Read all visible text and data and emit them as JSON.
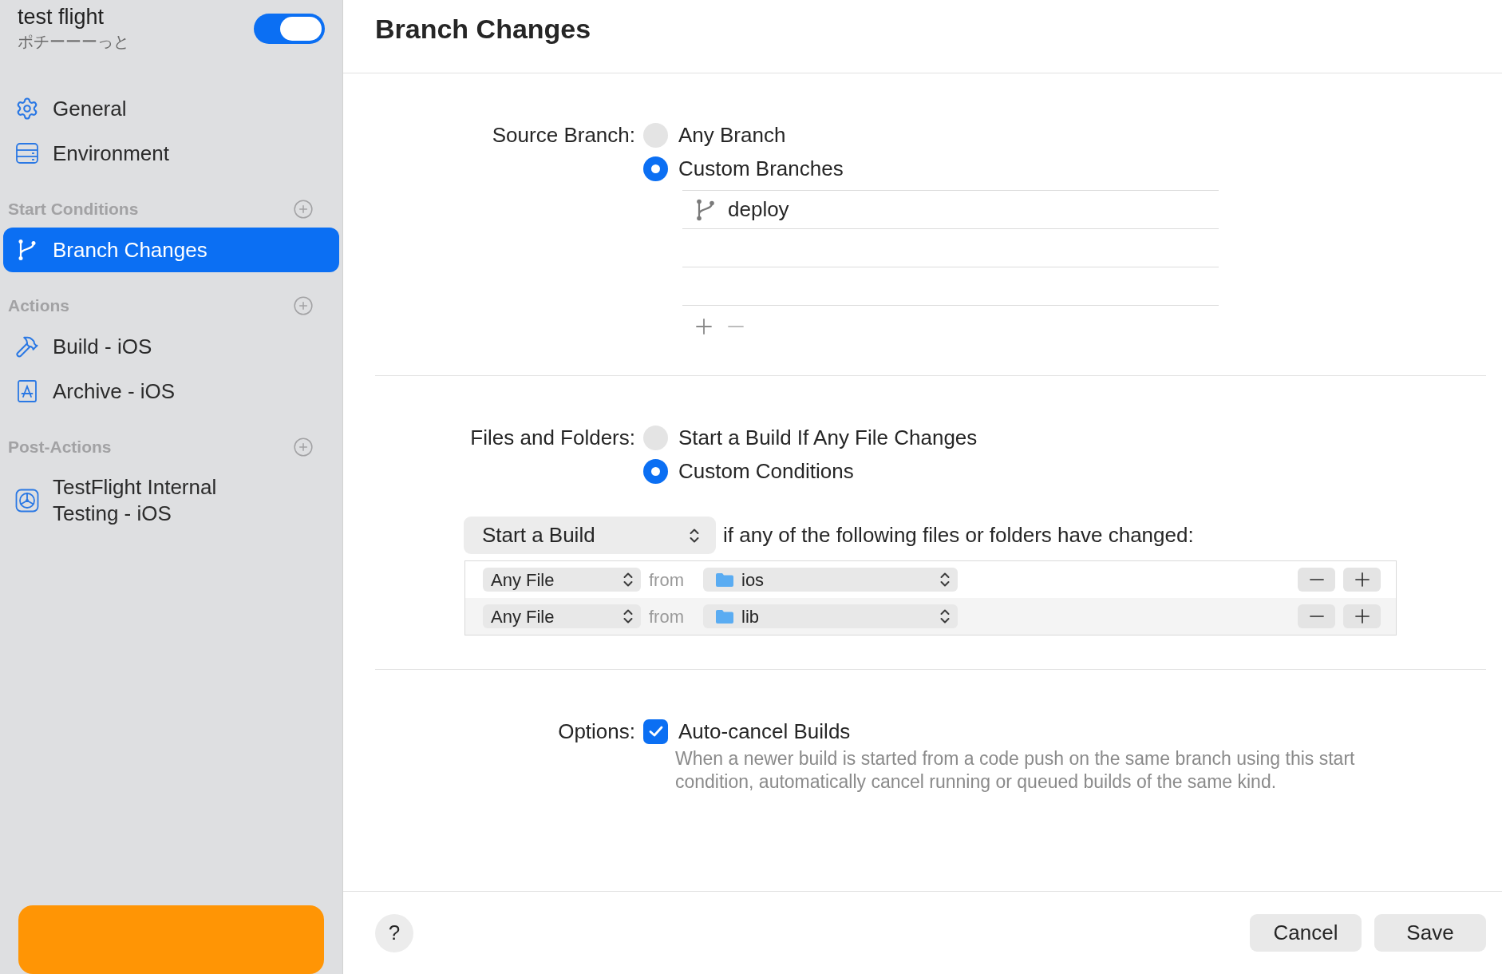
{
  "sidebar": {
    "workflow": {
      "title": "test flight",
      "subtitle": "ポチーーーっと",
      "enabled": true
    },
    "groups": [
      {
        "items": [
          {
            "kind": "general",
            "label": "General",
            "selected": false
          },
          {
            "kind": "environment",
            "label": "Environment",
            "selected": false
          }
        ]
      },
      {
        "title": "Start Conditions",
        "items": [
          {
            "kind": "branch",
            "label": "Branch Changes",
            "selected": true
          }
        ]
      },
      {
        "title": "Actions",
        "items": [
          {
            "kind": "build",
            "label": "Build - iOS",
            "selected": false
          },
          {
            "kind": "archive",
            "label": "Archive - iOS",
            "selected": false
          }
        ]
      },
      {
        "title": "Post-Actions",
        "items": [
          {
            "kind": "testflight",
            "label": "TestFlight Internal Testing - iOS",
            "selected": false
          }
        ]
      }
    ]
  },
  "main": {
    "title": "Branch Changes",
    "source_branch": {
      "label": "Source Branch:",
      "options": [
        {
          "label": "Any Branch",
          "selected": false
        },
        {
          "label": "Custom Branches",
          "selected": true
        }
      ],
      "branches": [
        "deploy"
      ]
    },
    "files_and_folders": {
      "label": "Files and Folders:",
      "options": [
        {
          "label": "Start a Build If Any File Changes",
          "selected": false
        },
        {
          "label": "Custom Conditions",
          "selected": true
        }
      ],
      "action": "Start a Build",
      "condition": "if any of the following files or folders have changed:",
      "rules": [
        {
          "match": "Any File",
          "joiner": "from",
          "folder": "ios"
        },
        {
          "match": "Any File",
          "joiner": "from",
          "folder": "lib"
        }
      ]
    },
    "options": {
      "label": "Options:",
      "items": [
        {
          "label": "Auto-cancel Builds",
          "checked": true,
          "description": "When a newer build is started from a code push on the same branch using this start condition, automatically cancel running or queued builds of the same kind."
        }
      ]
    }
  },
  "footer": {
    "help": "?",
    "buttons": [
      "Cancel",
      "Save"
    ]
  }
}
